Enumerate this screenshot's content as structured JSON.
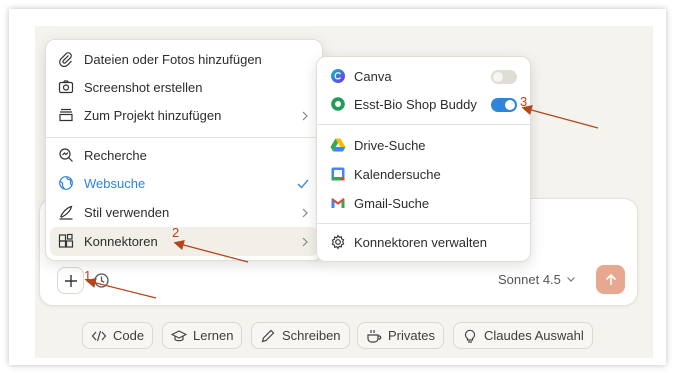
{
  "attach_menu": {
    "items": [
      {
        "label": "Dateien oder Fotos hinzufügen",
        "icon": "paperclip-icon"
      },
      {
        "label": "Screenshot erstellen",
        "icon": "camera-icon"
      },
      {
        "label": "Zum Projekt hinzufügen",
        "icon": "project-icon"
      },
      {
        "label": "Recherche",
        "icon": "research-icon"
      },
      {
        "label": "Websuche",
        "icon": "globe-icon",
        "checked": true
      },
      {
        "label": "Stil verwenden",
        "icon": "pen-icon"
      },
      {
        "label": "Konnektoren",
        "icon": "connectors-icon",
        "highlighted": true
      }
    ]
  },
  "connectors_menu": {
    "items": [
      {
        "label": "Canva",
        "icon": "canva-icon",
        "enabled": false
      },
      {
        "label": "Esst-Bio Shop Buddy",
        "icon": "shop-buddy-icon",
        "enabled": true
      },
      {
        "label": "Drive-Suche",
        "icon": "google-drive-icon"
      },
      {
        "label": "Kalendersuche",
        "icon": "google-calendar-icon"
      },
      {
        "label": "Gmail-Suche",
        "icon": "gmail-icon"
      },
      {
        "label": "Konnektoren verwalten",
        "icon": "gear-icon"
      }
    ]
  },
  "composer": {
    "model_label": "Sonnet 4.5"
  },
  "chips": [
    {
      "label": "Code",
      "icon": "code-icon"
    },
    {
      "label": "Lernen",
      "icon": "graduation-cap-icon"
    },
    {
      "label": "Schreiben",
      "icon": "pencil-icon"
    },
    {
      "label": "Privates",
      "icon": "coffee-cup-icon"
    },
    {
      "label": "Claudes Auswahl",
      "icon": "lightbulb-icon"
    }
  ],
  "annotations": [
    "1",
    "2",
    "3"
  ],
  "colors": {
    "accent_blue": "#2c84db",
    "send_button": "#e8a88f",
    "annotation": "#b5451b",
    "websuche_blue": "#2c84db"
  }
}
